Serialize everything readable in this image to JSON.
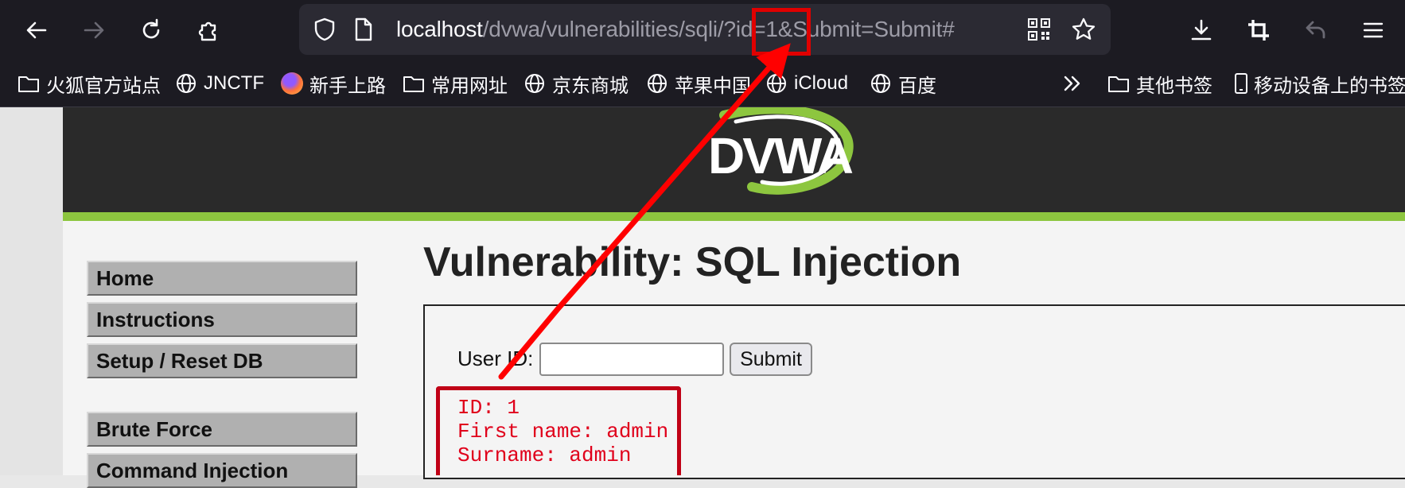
{
  "browser": {
    "url_host": "localhost",
    "url_path": "/dvwa/vulnerabilities/sqli/?id=1&Submit=Submit#",
    "bookmarks": [
      {
        "label": "火狐官方站点",
        "icon": "folder-icon"
      },
      {
        "label": "JNCTF",
        "icon": "globe-icon"
      },
      {
        "label": "新手上路",
        "icon": "firefox-icon"
      },
      {
        "label": "常用网址",
        "icon": "folder-icon"
      },
      {
        "label": "京东商城",
        "icon": "globe-icon"
      },
      {
        "label": "苹果中国",
        "icon": "globe-icon"
      },
      {
        "label": "iCloud",
        "icon": "globe-icon"
      },
      {
        "label": "百度",
        "icon": "globe-icon"
      }
    ],
    "other_bookmarks": "其他书签",
    "mobile_bookmarks": "移动设备上的书签"
  },
  "dvwa": {
    "logo": "DVWA",
    "menu": [
      "Home",
      "Instructions",
      "Setup / Reset DB",
      "Brute Force",
      "Command Injection"
    ],
    "title": "Vulnerability: SQL Injection",
    "form": {
      "label": "User ID:",
      "input_value": "",
      "submit_label": "Submit"
    },
    "result": {
      "id_line": "ID: 1",
      "first_line": "First name: admin",
      "surname_line": "Surname: admin"
    }
  },
  "colors": {
    "annotation": "#e00000",
    "result_text": "#e0001b",
    "header_green": "#8dc63f",
    "chrome_bg": "#1c1b22"
  }
}
